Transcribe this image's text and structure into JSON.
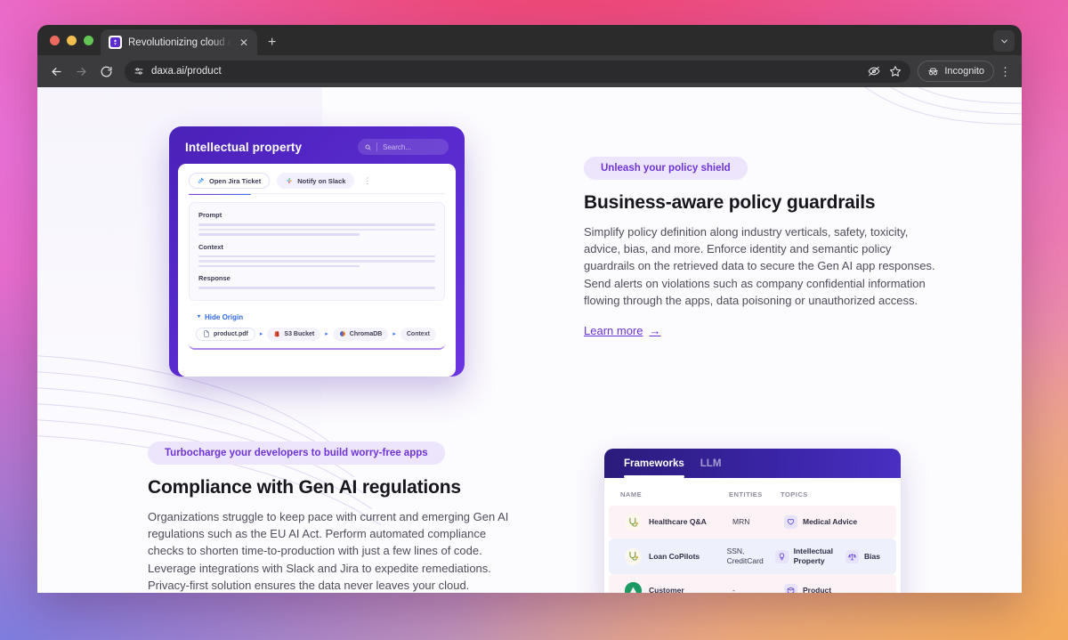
{
  "browser": {
    "tab": {
      "title": "Revolutionizing cloud data se",
      "favicon_name": "daxa-favicon",
      "close_label": "✕"
    },
    "newtab_label": "+",
    "tabstrip_chevron": "chevron-down-icon",
    "toolbar": {
      "back": "←",
      "forward": "→",
      "reload": "⟳",
      "site_settings_icon": "tune-icon",
      "url": "daxa.ai/product",
      "blocked_view_icon": "eye-slash-icon",
      "bookmark_icon": "star-icon",
      "incognito_label": "Incognito",
      "menu_label": "⋮"
    }
  },
  "ip_card": {
    "title": "Intellectual property",
    "search_placeholder": "Search...",
    "chips": [
      {
        "label": "Open Jira Ticket",
        "icon": "jira-icon"
      },
      {
        "label": "Notify on Slack",
        "icon": "slack-icon"
      }
    ],
    "chip_more": "⋮",
    "sections": [
      {
        "label": "Prompt"
      },
      {
        "label": "Context"
      },
      {
        "label": "Response"
      }
    ],
    "origin": {
      "toggle_label": "Hide Origin",
      "caret": "▾",
      "nodes": [
        {
          "label": "product.pdf",
          "icon": "file-icon"
        },
        {
          "label": "S3 Bucket",
          "icon": "aws-s3-icon"
        },
        {
          "label": "ChromaDB",
          "icon": "chromadb-icon"
        },
        {
          "label": "Context",
          "icon": "none"
        }
      ],
      "arrow": "▸"
    }
  },
  "section_right": {
    "pill": "Unleash your policy shield",
    "heading": "Business-aware policy guardrails",
    "body": "Simplify policy definition along industry verticals, safety, toxicity, advice, bias, and more. Enforce identity and semantic policy guardrails on the retrieved data to secure the Gen AI app responses. Send alerts on violations such as company confidential information flowing through the apps, data poisoning or unauthorized access.",
    "link": "Learn more",
    "link_arrow": "→"
  },
  "section_left": {
    "pill": "Turbocharge your developers to build worry-free apps",
    "heading": "Compliance with Gen AI regulations",
    "body": "Organizations struggle to keep pace with current and emerging Gen AI regulations such as the EU AI Act. Perform automated compliance checks to shorten time-to-production with just a few lines of code. Leverage integrations with Slack and Jira to expedite remediations. Privacy-first solution ensures the data never leaves your cloud."
  },
  "frameworks_card": {
    "tabs": [
      {
        "label": "Frameworks",
        "active": true
      },
      {
        "label": "LLM",
        "active": false
      }
    ],
    "columns": [
      "NAME",
      "ENTITIES",
      "TOPICS"
    ],
    "rows": [
      {
        "name": "Healthcare Q&A",
        "avatar": "healthcare-avatar",
        "entities": "MRN",
        "topics": [
          {
            "label": "Medical Advice",
            "icon": "heart-icon"
          }
        ],
        "tone": "pink"
      },
      {
        "name": "Loan CoPilots",
        "avatar": "loan-avatar",
        "entities": "SSN, CreditCard",
        "topics": [
          {
            "label": "Intellectual Property",
            "icon": "bulb-icon"
          },
          {
            "label": "Bias",
            "icon": "scales-icon"
          }
        ],
        "tone": "blue"
      },
      {
        "name": "Customer",
        "avatar": "customer-avatar",
        "entities": "-",
        "topics": [
          {
            "label": "Product",
            "icon": "box-icon"
          }
        ],
        "tone": "pink2"
      }
    ]
  },
  "colors": {
    "brand_purple": "#6b33d6",
    "card_purple": "#4a21b8",
    "pill_bg": "#ece5fb",
    "link": "#6b33d6",
    "table_header_gradient_start": "#2b1b7a"
  }
}
